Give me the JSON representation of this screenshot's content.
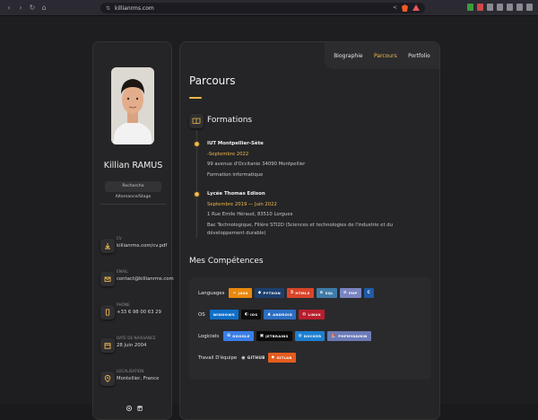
{
  "browser": {
    "url": "killianrms.com"
  },
  "profile": {
    "name": "Killian RAMUS",
    "tag": "Recherche Alternance/Stage",
    "contacts": [
      {
        "label": "CV",
        "value": "killianrms.com/cv.pdf",
        "icon": "cv-icon"
      },
      {
        "label": "EMAIL",
        "value": "contact@killianrms.com",
        "icon": "mail-icon"
      },
      {
        "label": "PHONE",
        "value": "+33 6 98 00 63 29",
        "icon": "phone-icon"
      },
      {
        "label": "DATE DE NAISSANCE",
        "value": "28 Juin 2004",
        "icon": "calendar-icon"
      },
      {
        "label": "LOCALISATION",
        "value": "Montellier, France",
        "icon": "location-icon"
      }
    ]
  },
  "tabs": [
    "Biographie",
    "Parcours",
    "Portfolio"
  ],
  "main": {
    "title": "Parcours",
    "formations_title": "Formations",
    "formations": [
      {
        "school": "IUT Montpellier-Sète",
        "date": "-Septembre 2022",
        "address": "99 avenue d'Occitanie 34090 Montpellier",
        "program": "Formation informatique"
      },
      {
        "school": "Lycée Thomas Edison",
        "date": "Septembre 2019 — Juin 2022",
        "address": "1 Rue Emile Héraud, 83510 Lorgues",
        "program": "Bac Technologique, Filière STI2D (Sciences et technologies de l'industrie et du développement durable)"
      }
    ],
    "skills_title": "Mes Compétences",
    "skills": [
      {
        "label": "Languages",
        "badges": [
          {
            "text": "JAVA",
            "color": "#e8890c",
            "glyph": "☕"
          },
          {
            "text": "PYTHON",
            "color": "#1d3f6e",
            "glyph": "◆"
          },
          {
            "text": "HTML5",
            "color": "#d8452a",
            "glyph": "5"
          },
          {
            "text": "SQL",
            "color": "#3f7ba8",
            "glyph": "≡"
          },
          {
            "text": "PHP",
            "color": "#7a84c0",
            "glyph": "⊙"
          },
          {
            "text": "C",
            "color": "#1f5aa8",
            "glyph": "C"
          }
        ]
      },
      {
        "label": "OS",
        "badges": [
          {
            "text": "WINDOWS",
            "color": "#0f6fc6",
            "glyph": ""
          },
          {
            "text": "IOS",
            "color": "#0c0c0c",
            "glyph": "◐"
          },
          {
            "text": "ANDROID",
            "color": "#2b6ec4",
            "glyph": "▲"
          },
          {
            "text": "LINUX",
            "color": "#b81e2c",
            "glyph": "◍"
          }
        ]
      },
      {
        "label": "Logiciels",
        "badges": [
          {
            "text": "GOOGLE",
            "color": "#3a7ee6",
            "glyph": "G"
          },
          {
            "text": "JETBRAINS",
            "color": "#0a0a0a",
            "glyph": "▣"
          },
          {
            "text": "DOCKER",
            "color": "#1d7fd0",
            "glyph": "◍"
          },
          {
            "text": "PHPMYADMIN",
            "color": "#6c7bb8",
            "glyph": "⛵"
          }
        ]
      },
      {
        "label": "Travail D'équipe",
        "badges": [
          {
            "text": "GITHUB",
            "color": "",
            "glyph": "◉"
          },
          {
            "text": "GITLAB",
            "color": "#e55c1e",
            "glyph": "◆"
          }
        ]
      }
    ]
  },
  "colors": {
    "accent": "#f0b94a",
    "bg": "#1e1e20",
    "card": "#252527"
  }
}
